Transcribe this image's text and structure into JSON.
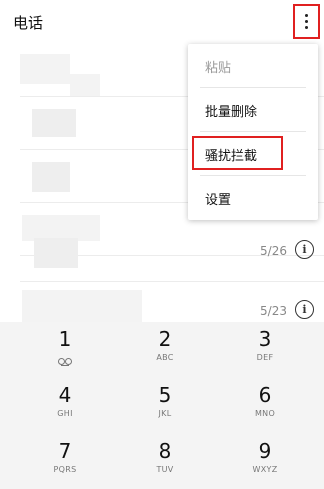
{
  "header": {
    "title": "电话"
  },
  "menu": {
    "items": [
      "粘贴",
      "批量删除",
      "骚扰拦截",
      "设置"
    ]
  },
  "calls": [
    {
      "date": ""
    },
    {
      "date": ""
    },
    {
      "date": ""
    },
    {
      "date": ""
    },
    {
      "date": "5/26"
    },
    {
      "date": "5/23"
    }
  ],
  "dialpad": {
    "keys": [
      {
        "num": "1",
        "letters": ""
      },
      {
        "num": "2",
        "letters": "ABC"
      },
      {
        "num": "3",
        "letters": "DEF"
      },
      {
        "num": "4",
        "letters": "GHI"
      },
      {
        "num": "5",
        "letters": "JKL"
      },
      {
        "num": "6",
        "letters": "MNO"
      },
      {
        "num": "7",
        "letters": "PQRS"
      },
      {
        "num": "8",
        "letters": "TUV"
      },
      {
        "num": "9",
        "letters": "WXYZ"
      }
    ]
  },
  "icons": {
    "info": "info-icon",
    "more": "more-vert-icon",
    "voicemail": "voicemail-icon"
  },
  "colors": {
    "highlight": "#e02020"
  }
}
